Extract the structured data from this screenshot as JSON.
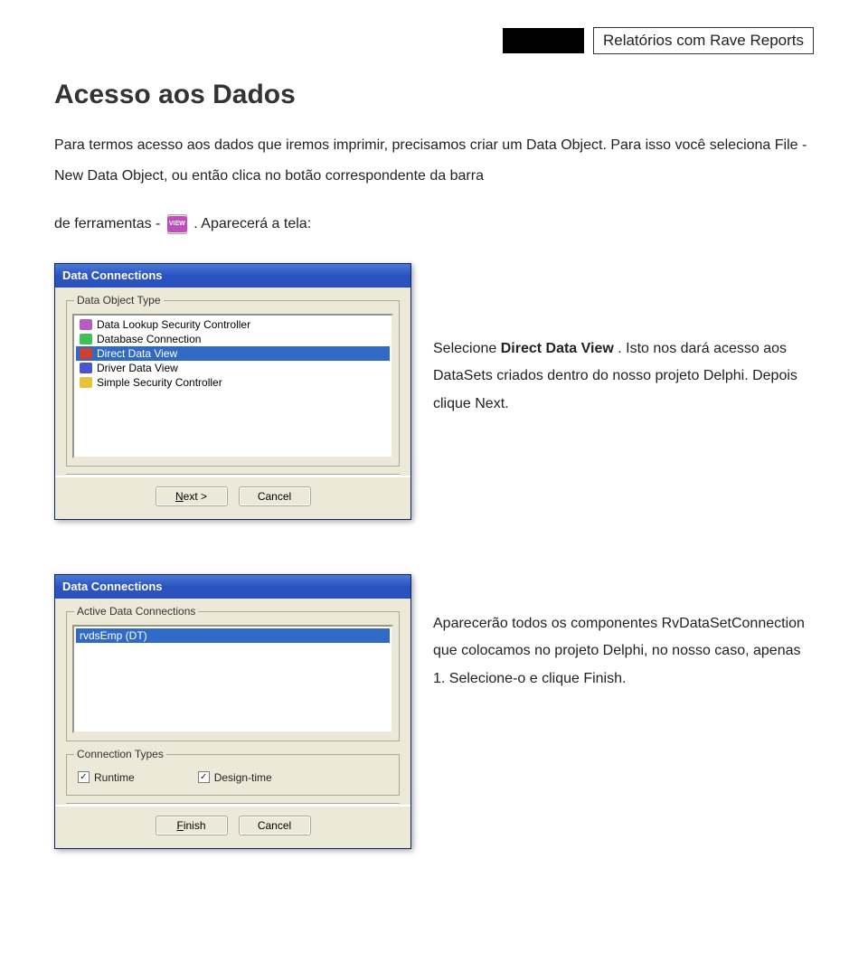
{
  "header": {
    "title": "Relatórios com Rave Reports"
  },
  "section": {
    "title": "Acesso aos Dados",
    "intro1": "Para termos acesso aos dados que iremos imprimir, precisamos criar um Data Object. Para isso você seleciona File - New Data Object, ou então clica no botão correspondente da barra",
    "intro2_prefix": "de ferramentas - ",
    "intro2_suffix": ". Aparecerá a tela:"
  },
  "dialog1": {
    "title": "Data Connections",
    "groupLabel": "Data Object Type",
    "items": [
      {
        "icon": "purple-lock",
        "label": "Data Lookup Security Controller"
      },
      {
        "icon": "green-db",
        "label": "Database Connection"
      },
      {
        "icon": "red-view",
        "label": "Direct Data View",
        "selected": true
      },
      {
        "icon": "blue-view",
        "label": "Driver Data View"
      },
      {
        "icon": "yellow-lock",
        "label": "Simple Security Controller"
      }
    ],
    "buttons": {
      "next": "Next >",
      "cancel": "Cancel"
    }
  },
  "aside1": {
    "prefix": "Selecione ",
    "bold": "Direct Data View",
    "suffix": ". Isto nos dará acesso aos DataSets criados dentro do nosso projeto Delphi. Depois clique Next."
  },
  "dialog2": {
    "title": "Data Connections",
    "groupLabel": "Active Data Connections",
    "items": [
      {
        "label": "rvdsEmp (DT)",
        "selected": true
      }
    ],
    "typesLabel": "Connection Types",
    "checkboxes": {
      "runtime": "Runtime",
      "designtime": "Design-time"
    },
    "buttons": {
      "finish": "Finish",
      "cancel": "Cancel"
    }
  },
  "aside2": {
    "text": "Aparecerão todos os componentes RvDataSetConnection que colocamos no projeto Delphi, no nosso caso, apenas 1. Selecione-o e clique Finish."
  }
}
